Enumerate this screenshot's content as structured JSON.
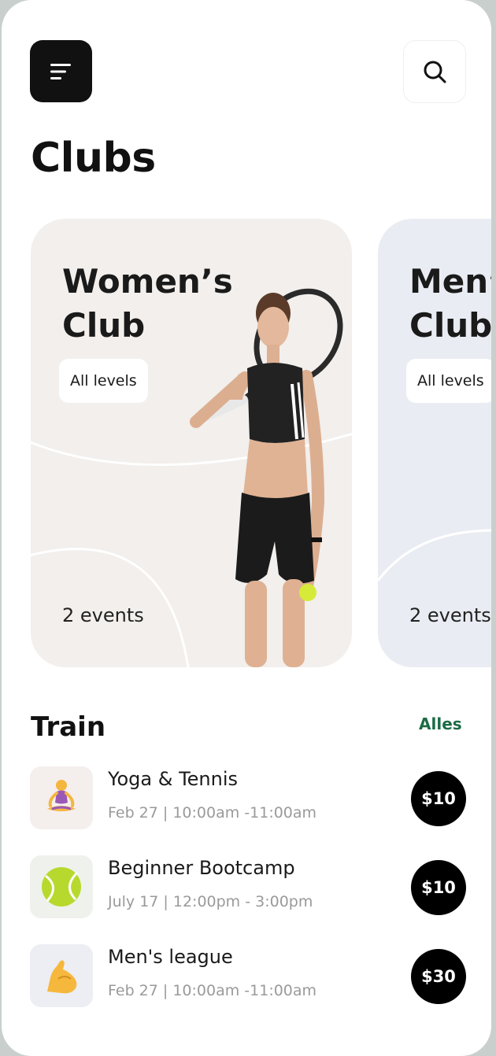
{
  "header": {
    "menu_icon": "menu-icon",
    "search_icon": "search-icon"
  },
  "page_title": "Clubs",
  "clubs": [
    {
      "name_line1": "Women’s",
      "name_line2": "Club",
      "level": "All levels",
      "events": "2 events",
      "card_color": "#f2efec"
    },
    {
      "name_line1": "Men’s",
      "name_line2": "Club",
      "level": "All levels",
      "events": "2 events",
      "card_color": "#e9ecf2"
    }
  ],
  "train": {
    "title": "Train",
    "see_all": "Alles",
    "items": [
      {
        "name": "Yoga & Tennis",
        "time": "Feb 27 | 10:00am -11:00am",
        "price": "$10",
        "icon": "meditation-icon"
      },
      {
        "name": "Beginner Bootcamp",
        "time": "July 17 | 12:00pm - 3:00pm",
        "price": "$10",
        "icon": "tennis-ball-icon"
      },
      {
        "name": "Men's league",
        "time": "Feb 27 | 10:00am -11:00am",
        "price": "$30",
        "icon": "flexed-biceps-icon"
      }
    ]
  },
  "colors": {
    "accent_green": "#1b6b45",
    "dark": "#111111",
    "price_badge": "#000000"
  }
}
